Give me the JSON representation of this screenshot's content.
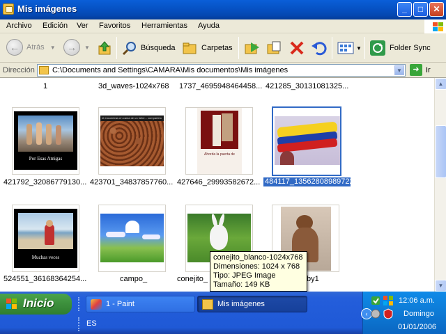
{
  "window": {
    "title": "Mis imágenes"
  },
  "menu": [
    "Archivo",
    "Edición",
    "Ver",
    "Favoritos",
    "Herramientas",
    "Ayuda"
  ],
  "toolbar": {
    "back": "Atrás",
    "search": "Búsqueda",
    "folders": "Carpetas",
    "folder_sync": "Folder Sync"
  },
  "address": {
    "label": "Dirección",
    "path": "C:\\Documents and Settings\\CAMARA\\Mis documentos\\Mis imágenes",
    "go": "Ir"
  },
  "files_top": [
    "1",
    "3d_waves-1024x768",
    "1737_4695948464458...",
    "421285_30131081325..."
  ],
  "files_row1": [
    {
      "name": "421792_32086779130...",
      "caption_text": "Por Esas Amigas"
    },
    {
      "name": "423701_34837857760...",
      "caption_text": "el encuentras en cama de un bebe... compartelo"
    },
    {
      "name": "427646_29993582672...",
      "caption_text": "Ahorda la puerta de"
    },
    {
      "name": "484117_135628089897221_100003500936720_134151_2048955073_n",
      "selected": true
    }
  ],
  "files_row2": [
    {
      "name": "524551_36168364254...",
      "caption_text": "Muchas veces"
    },
    {
      "name": "campo_"
    },
    {
      "name": "conejito_"
    },
    {
      "name": "by1"
    }
  ],
  "tooltip": {
    "line1": "conejito_blanco-1024x768",
    "line2": "Dimensiones: 1024 x 768",
    "line3": "Tipo: JPEG Image",
    "line4": "Tamaño: 149 KB"
  },
  "taskbar": {
    "start": "Inicio",
    "tasks": [
      "1 - Paint",
      "Mis imágenes"
    ],
    "lang": "ES",
    "time": "12:06 a.m.",
    "day": "Domingo",
    "date": "01/01/2006"
  }
}
